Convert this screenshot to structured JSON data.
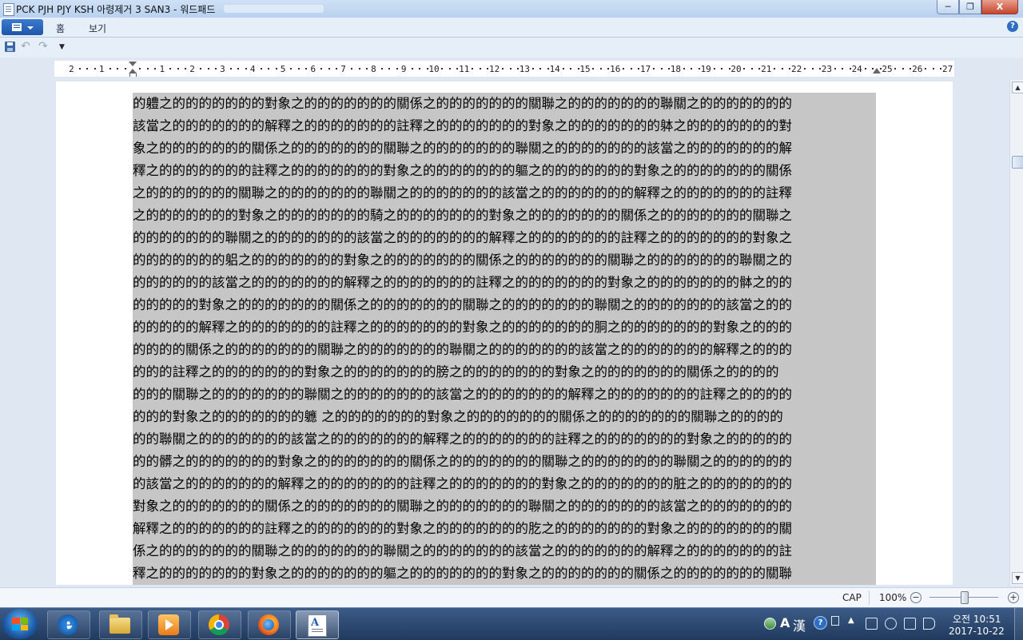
{
  "window": {
    "title": "PCK PJH PJY KSH 아령제거 3 SAN3 - 워드패드",
    "buttons": {
      "minimize": "─",
      "maximize": "❐",
      "close": "X"
    }
  },
  "ribbon": {
    "tabs": [
      "홈",
      "보기"
    ],
    "help": "?"
  },
  "quick_access": {
    "undo": "↶",
    "redo": "↷",
    "more": "▼"
  },
  "ruler": {
    "labels": [
      "2",
      "1",
      "",
      "1",
      "2",
      "3",
      "4",
      "5",
      "6",
      "7",
      "8",
      "9",
      "10",
      "11",
      "12",
      "13",
      "14",
      "15",
      "16",
      "17",
      "18",
      "19",
      "20",
      "21",
      "22",
      "23",
      "24",
      "25",
      "26",
      "27"
    ]
  },
  "document": {
    "lines": [
      "的軆之的的的的的的的對象之的的的的的的的關係之的的的的的的的關聯之的的的的的的的聯關之的的的的的的的",
      "該當之的的的的的的的解釋之的的的的的的的註釋之的的的的的的的對象之的的的的的的的躰之的的的的的的的對",
      "象之的的的的的的的關係之的的的的的的的關聯之的的的的的的的聯關之的的的的的的的該當之的的的的的的的解",
      "釋之的的的的的的的註釋之的的的的的的的對象之的的的的的的的軀之的的的的的的的對象之的的的的的的的關係",
      "之的的的的的的的關聯之的的的的的的的聯關之的的的的的的的該當之的的的的的的的解釋之的的的的的的的註釋",
      "之的的的的的的的對象之的的的的的的的騎之的的的的的的的對象之的的的的的的的關係之的的的的的的的關聯之",
      "的的的的的的的聯關之的的的的的的的該當之的的的的的的的解釋之的的的的的的的註釋之的的的的的的的對象之",
      "的的的的的的的躳之的的的的的的的對象之的的的的的的的關係之的的的的的的的關聯之的的的的的的的聯關之的",
      "的的的的的的該當之的的的的的的的解釋之的的的的的的的註釋之的的的的的的的對象之的的的的的的的骵之的的",
      "的的的的的對象之的的的的的的的關係之的的的的的的的關聯之的的的的的的的聯關之的的的的的的的該當之的的",
      "的的的的的解釋之的的的的的的的註釋之的的的的的的的對象之的的的的的的的胴之的的的的的的的對象之的的的",
      "的的的的關係之的的的的的的的關聯之的的的的的的的聯關之的的的的的的的該當之的的的的的的的解釋之的的的",
      "的的的註釋之的的的的的的的對象之的的的的的的的膀之的的的的的的的對象之的的的的的的的關係之的的的的",
      "的的的關聯之的的的的的的的聯關之的的的的的的的該當之的的的的的的的解釋之的的的的的的的註釋之的的的的",
      "的的的對象之的的的的的的的軈 之的的的的的的的對象之的的的的的的的關係之的的的的的的的關聯之的的的的",
      "的的聯關之的的的的的的的該當之的的的的的的的解釋之的的的的的的的註釋之的的的的的的的對象之的的的的的",
      "的的髒之的的的的的的的對象之的的的的的的的關係之的的的的的的的關聯之的的的的的的的聯關之的的的的的的",
      "的該當之的的的的的的的解釋之的的的的的的的註釋之的的的的的的的對象之的的的的的的的脏之的的的的的的的",
      "對象之的的的的的的的關係之的的的的的的的關聯之的的的的的的的聯關之的的的的的的的該當之的的的的的的的",
      "解釋之的的的的的的的註釋之的的的的的的的對象之的的的的的的的肐之的的的的的的的對象之的的的的的的的關",
      "係之的的的的的的的關聯之的的的的的的的聯關之的的的的的的的該當之的的的的的的的解釋之的的的的的的的註",
      "釋之的的的的的的的對象之的的的的的的的軀之的的的的的的的對象之的的的的的的的關係之的的的的的的的關聯"
    ]
  },
  "scrollbar": {
    "up": "▲",
    "down": "▼"
  },
  "statusbar": {
    "cap": "CAP",
    "zoom": "100%",
    "zoom_out": "−",
    "zoom_in": "+",
    "zoom_level_percent": 100
  },
  "taskbar": {
    "apps": [
      "internet-explorer",
      "file-explorer",
      "media-player",
      "chrome",
      "firefox",
      "wordpad"
    ],
    "ime_mode": "A",
    "ime_hanja": "漢",
    "ime_help": "?",
    "clock_time": "오전 10:51",
    "clock_date": "2017-10-22"
  },
  "colors": {
    "selection": "#c6c6c6",
    "titlebar": "#b9d1ee",
    "taskbar": "#203a5f"
  }
}
